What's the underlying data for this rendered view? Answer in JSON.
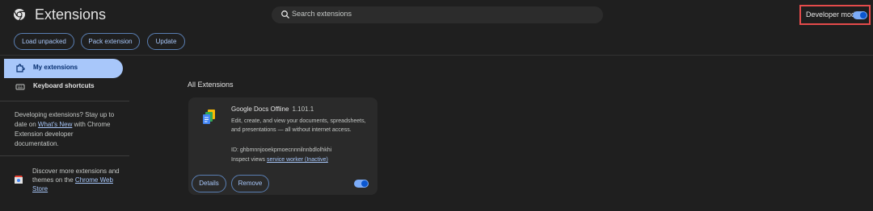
{
  "header": {
    "title": "Extensions",
    "search_placeholder": "Search extensions",
    "developer_mode_label": "Developer mode",
    "developer_mode_on": true,
    "highlight_color": "#e54b4b"
  },
  "toolbar": {
    "load_unpacked": "Load unpacked",
    "pack_extension": "Pack extension",
    "update": "Update"
  },
  "sidebar": {
    "items": [
      {
        "label": "My extensions",
        "icon": "extension-puzzle-icon",
        "active": true
      },
      {
        "label": "Keyboard shortcuts",
        "icon": "keyboard-icon",
        "active": false
      }
    ],
    "dev_text_before": "Developing extensions? Stay up to date on ",
    "dev_link": "What's New",
    "dev_text_after": " with Chrome Extension developer documentation.",
    "store_text": "Discover more extensions and themes on the ",
    "store_link": "Chrome Web Store"
  },
  "main": {
    "section_title": "All Extensions",
    "extensions": [
      {
        "name": "Google Docs Offline",
        "version": "1.101.1",
        "description": "Edit, create, and view your documents, spreadsheets, and presentations — all without internet access.",
        "id_label": "ID: ghbmnnjooekpmoecnnnilnnbdlolhkhi",
        "inspect_label": "Inspect views ",
        "inspect_link": "service worker (Inactive)",
        "details_label": "Details",
        "remove_label": "Remove",
        "enabled": true
      }
    ]
  },
  "colors": {
    "background": "#1f1f1f",
    "accent": "#a8c7fa",
    "card": "#2a2a2a"
  }
}
